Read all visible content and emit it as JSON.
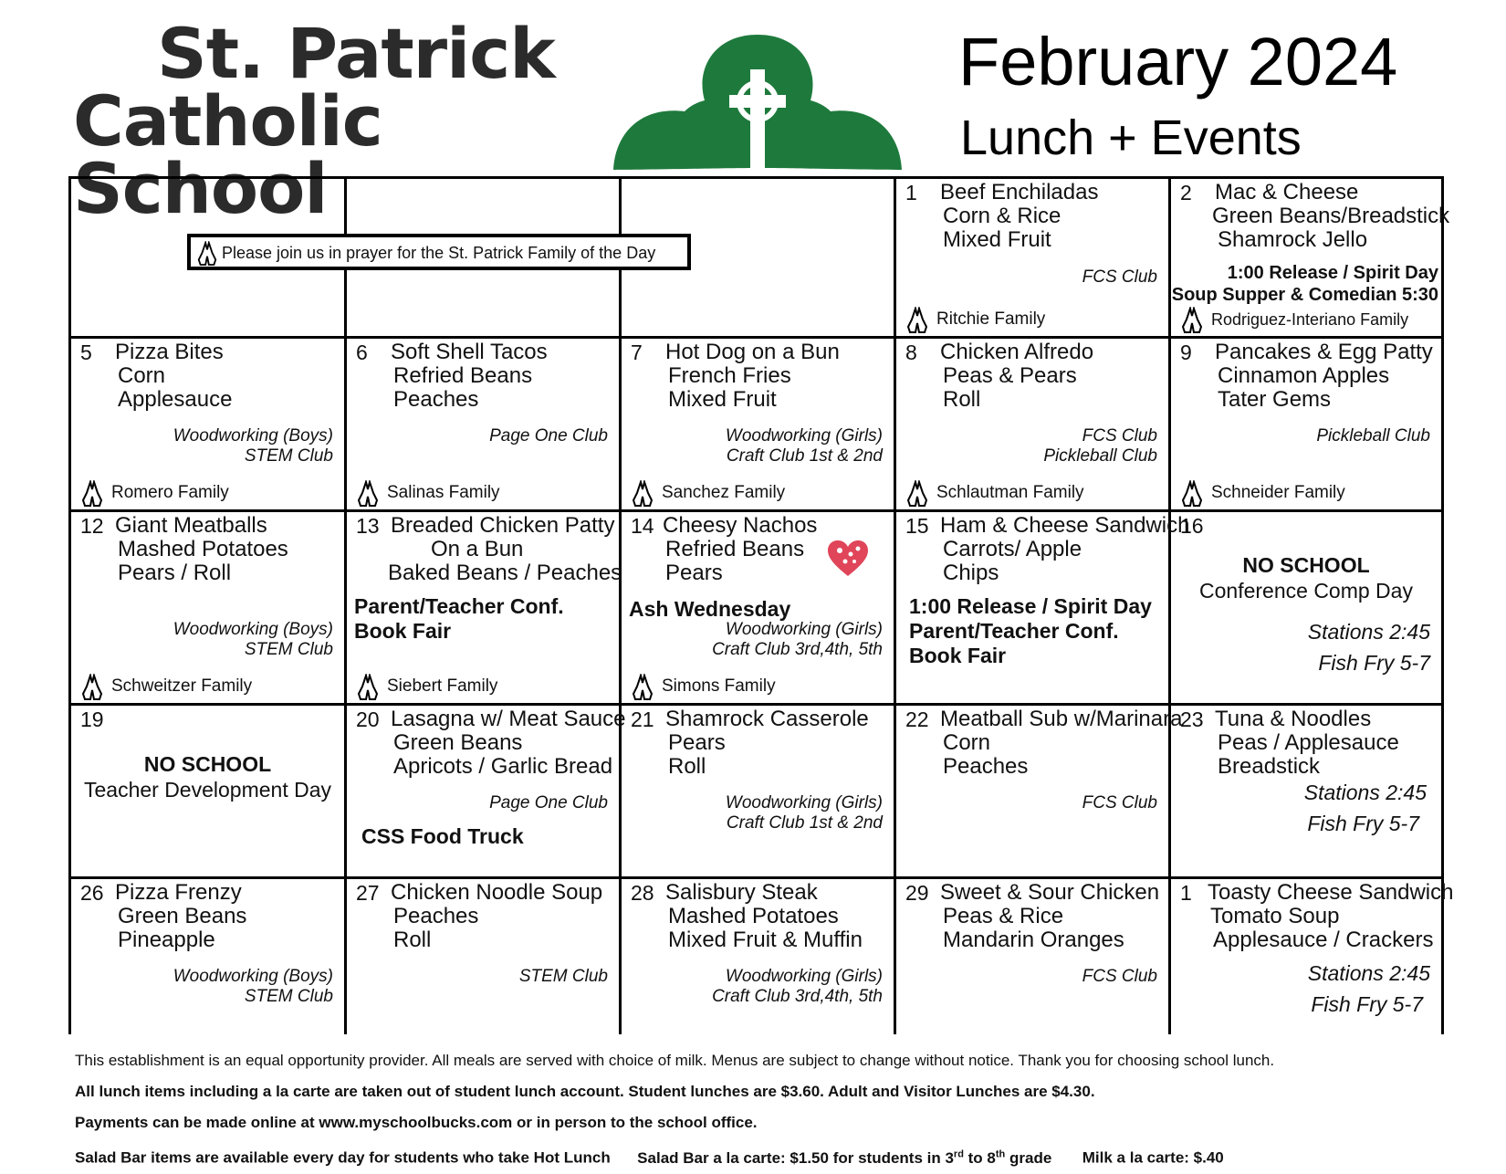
{
  "header": {
    "school_line1": "St. Patrick",
    "school_line2": "Catholic School",
    "month": "February 2024",
    "subtitle": "Lunch + Events"
  },
  "prayer_banner": "Please join us in prayer for the St. Patrick Family of the Day",
  "colors": {
    "shamrock": "#1e7a3c",
    "heart": "#e0455a"
  },
  "icons": {
    "family": "praying-hands-icon",
    "valentine": "heart-icon",
    "logo": "shamrock-cross-logo"
  },
  "days": [
    {
      "num": "1",
      "meals": [
        "Beef Enchiladas",
        "Corn & Rice",
        "Mixed Fruit"
      ],
      "clubs": [
        "FCS Club"
      ],
      "family": "Ritchie Family"
    },
    {
      "num": "2",
      "meals": [
        "Mac & Cheese",
        "Green Beans/Breadstick",
        "Shamrock Jello"
      ],
      "events": [
        "1:00 Release / Spirit Day",
        "Soup Supper & Comedian 5:30"
      ],
      "family": "Rodriguez-Interiano Family"
    },
    {
      "num": "5",
      "meals": [
        "Pizza Bites",
        "Corn",
        "Applesauce"
      ],
      "clubs": [
        "Woodworking (Boys)",
        "STEM Club"
      ],
      "family": "Romero Family"
    },
    {
      "num": "6",
      "meals": [
        "Soft Shell Tacos",
        "Refried Beans",
        "Peaches"
      ],
      "clubs": [
        "Page One Club"
      ],
      "family": "Salinas Family"
    },
    {
      "num": "7",
      "meals": [
        "Hot Dog on a Bun",
        "French Fries",
        "Mixed Fruit"
      ],
      "clubs": [
        "Woodworking (Girls)",
        "Craft Club 1st & 2nd"
      ],
      "family": "Sanchez Family"
    },
    {
      "num": "8",
      "meals": [
        "Chicken Alfredo",
        "Peas & Pears",
        "Roll"
      ],
      "clubs": [
        "FCS Club",
        "Pickleball Club"
      ],
      "family": "Schlautman Family"
    },
    {
      "num": "9",
      "meals": [
        "Pancakes & Egg Patty",
        "Cinnamon Apples",
        "Tater Gems"
      ],
      "clubs": [
        "Pickleball Club"
      ],
      "family": "Schneider Family"
    },
    {
      "num": "12",
      "meals": [
        "Giant Meatballs",
        "Mashed Potatoes",
        "Pears / Roll"
      ],
      "clubs": [
        "Woodworking (Boys)",
        "STEM Club"
      ],
      "family": "Schweitzer Family"
    },
    {
      "num": "13",
      "meals": [
        "Breaded Chicken Patty",
        "On a Bun",
        "Baked Beans / Peaches"
      ],
      "events": [
        "Parent/Teacher Conf.",
        "Book Fair"
      ],
      "family": "Siebert Family"
    },
    {
      "num": "14",
      "meals": [
        "Cheesy Nachos",
        "Refried Beans",
        "Pears"
      ],
      "events": [
        "Ash Wednesday"
      ],
      "clubs": [
        "Woodworking (Girls)",
        "Craft Club 3rd,4th, 5th"
      ],
      "family": "Simons Family"
    },
    {
      "num": "15",
      "meals": [
        "Ham & Cheese Sandwich",
        "Carrots/ Apple",
        "Chips"
      ],
      "events": [
        "1:00 Release / Spirit Day",
        "Parent/Teacher Conf.",
        "Book Fair"
      ]
    },
    {
      "num": "16",
      "no_school": "NO SCHOOL",
      "no_school_reason": "Conference Comp Day",
      "stations": [
        "Stations 2:45",
        "Fish Fry 5-7"
      ]
    },
    {
      "num": "19",
      "no_school": "NO SCHOOL",
      "no_school_reason": "Teacher Development Day"
    },
    {
      "num": "20",
      "meals": [
        "Lasagna w/ Meat Sauce",
        "Green Beans",
        "Apricots / Garlic Bread"
      ],
      "clubs": [
        "Page One Club"
      ],
      "events": [
        "CSS Food Truck"
      ]
    },
    {
      "num": "21",
      "meals": [
        "Shamrock Casserole",
        "Pears",
        "Roll"
      ],
      "clubs": [
        "Woodworking (Girls)",
        "Craft Club 1st & 2nd"
      ]
    },
    {
      "num": "22",
      "meals": [
        "Meatball Sub w/Marinara",
        "Corn",
        "Peaches"
      ],
      "clubs": [
        "FCS Club"
      ]
    },
    {
      "num": "23",
      "meals": [
        "Tuna & Noodles",
        "Peas / Applesauce",
        "Breadstick"
      ],
      "stations": [
        "Stations 2:45",
        "Fish Fry 5-7"
      ]
    },
    {
      "num": "26",
      "meals": [
        "Pizza Frenzy",
        "Green Beans",
        "Pineapple"
      ],
      "clubs": [
        "Woodworking (Boys)",
        "STEM Club"
      ]
    },
    {
      "num": "27",
      "meals": [
        "Chicken Noodle Soup",
        "Peaches",
        "Roll"
      ],
      "clubs": [
        "STEM Club"
      ]
    },
    {
      "num": "28",
      "meals": [
        "Salisbury Steak",
        "Mashed Potatoes",
        "Mixed Fruit & Muffin"
      ],
      "clubs": [
        "Woodworking (Girls)",
        "Craft Club 3rd,4th, 5th"
      ]
    },
    {
      "num": "29",
      "meals": [
        "Sweet & Sour Chicken",
        "Peas & Rice",
        "Mandarin Oranges"
      ],
      "clubs": [
        "FCS Club"
      ]
    },
    {
      "num": "1",
      "meals": [
        "Toasty Cheese Sandwich",
        "Tomato Soup",
        "Applesauce / Crackers"
      ],
      "stations": [
        "Stations 2:45",
        "Fish Fry 5-7"
      ]
    }
  ],
  "footer": {
    "line1": "This establishment is an equal opportunity provider.  All meals are served with choice of milk.  Menus are subject to change without notice.  Thank you for choosing school lunch.",
    "line2": "All lunch items including a la carte are taken out of student lunch account. Student lunches are $3.60.  Adult and Visitor Lunches are $4.30.",
    "line3": "Payments can be made online at www.myschoolbucks.com or in person to the school office.",
    "line4a": "Salad Bar items are available every day for students who take Hot Lunch",
    "line4b": "Salad Bar a la carte: $1.50 for students in 3",
    "line4b_sup1": "rd",
    "line4b_mid": " to 8",
    "line4b_sup2": "th",
    "line4b_end": " grade",
    "line4c": "Milk a la carte: $.40"
  }
}
